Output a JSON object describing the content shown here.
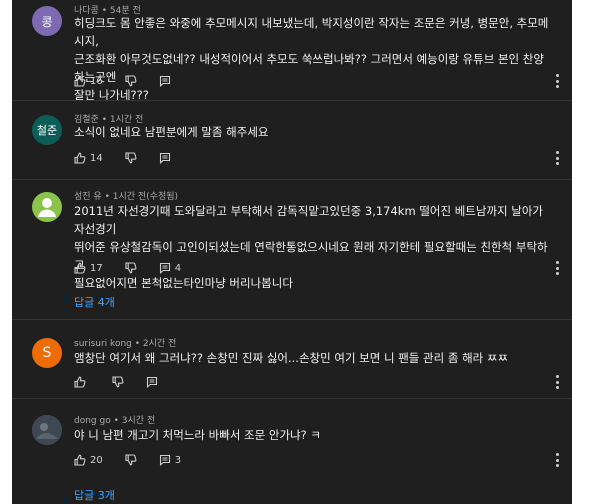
{
  "comments": [
    {
      "avatar_text": "콩",
      "avatar_color": "#7e6ab3",
      "author": "나다콩",
      "time": "54분 전",
      "lines": [
        "히딩크도 몸 안좋은 와중에 추모메시지 내보냈는데,  박지성이란 작자는 조문은 커녕, 병문안, 추모메시지,",
        "근조화환  아무것도없네??  내성적이어서 추모도 쑥쓰럽나봐??  그러면서 예능이랑 유튜브 본인 찬양하는곳엔",
        "잘만 나가네???"
      ],
      "likes": "16",
      "replies_count": "",
      "replies_link": ""
    },
    {
      "avatar_text": "철준",
      "avatar_color": "#0b5e57",
      "author": "김철준",
      "time": "1시간 전",
      "lines": [
        "소식이 없네요 남편분에게 말좀 해주세요"
      ],
      "likes": "14",
      "replies_count": "",
      "replies_link": ""
    },
    {
      "avatar_text": "",
      "avatar_color": "#8bc34a",
      "author": "성진 유",
      "time": "1시간 전(수정됨)",
      "lines": [
        "2011년 자선경기때 도와달라고 부탁해서 감독직맡고있던중 3,174km 떨어진 베트남까지 날아가 자선경기",
        "뛰어준 유상철감독이 고인이되셨는데 연락한통없으시네요 원래 자기한테 필요할때는 친한척 부탁하고",
        "필요없어지면 본척없는타인마냥 버리나봅니다"
      ],
      "likes": "17",
      "replies_count": "4",
      "replies_link": "답글 4개"
    },
    {
      "avatar_text": "S",
      "avatar_color": "#ef6c00",
      "author": "surisuri kong",
      "time": "2시간 전",
      "lines": [
        "앰창단 여기서 왜 그러냐?? 손창민 진짜 싫어...손창민 여기 보면 니 팬들 관리 좀 해라 ㅉㅉ"
      ],
      "likes": "",
      "replies_count": "",
      "replies_link": ""
    },
    {
      "avatar_text": "",
      "avatar_color": "#4d5661",
      "author": "dong go",
      "time": "3시간 전",
      "lines": [
        "야 니 남편 개고기 처먹느라 바빠서 조문 안가냐? ㅋ"
      ],
      "likes": "20",
      "replies_count": "3",
      "replies_link": "답글 3개"
    }
  ],
  "dot_separator": " • "
}
